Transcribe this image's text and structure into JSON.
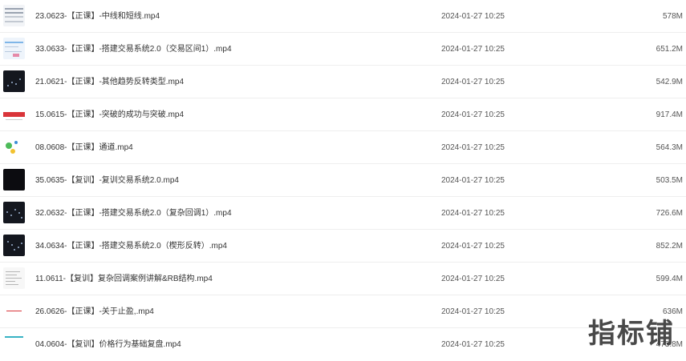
{
  "files": [
    {
      "name": "23.0623-【正课】-中线和短线.mp4",
      "date": "2024-01-27 10:25",
      "size": "578M",
      "thumb_icon": "video-thumbnail-slides"
    },
    {
      "name": "33.0633-【正课】-搭建交易系统2.0（交易区间1）.mp4",
      "date": "2024-01-27 10:25",
      "size": "651.2M",
      "thumb_icon": "video-thumbnail-light"
    },
    {
      "name": "21.0621-【正课】-其他趋势反转类型.mp4",
      "date": "2024-01-27 10:25",
      "size": "542.9M",
      "thumb_icon": "video-thumbnail-dark"
    },
    {
      "name": "15.0615-【正课】-突破的成功与突破.mp4",
      "date": "2024-01-27 10:25",
      "size": "917.4M",
      "thumb_icon": "video-thumbnail-red"
    },
    {
      "name": "08.0608-【正课】通道.mp4",
      "date": "2024-01-27 10:25",
      "size": "564.3M",
      "thumb_icon": "video-thumbnail-green"
    },
    {
      "name": "35.0635-【复训】-复训交易系统2.0.mp4",
      "date": "2024-01-27 10:25",
      "size": "503.5M",
      "thumb_icon": "video-thumbnail-black"
    },
    {
      "name": "32.0632-【正课】-搭建交易系统2.0（复杂回调1）.mp4",
      "date": "2024-01-27 10:25",
      "size": "726.6M",
      "thumb_icon": "video-thumbnail-dark"
    },
    {
      "name": "34.0634-【正课】-搭建交易系统2.0（楔形反转）.mp4",
      "date": "2024-01-27 10:25",
      "size": "852.2M",
      "thumb_icon": "video-thumbnail-dark"
    },
    {
      "name": "11.0611-【复训】复杂回调案例讲解&RB结构.mp4",
      "date": "2024-01-27 10:25",
      "size": "599.4M",
      "thumb_icon": "video-thumbnail-doc"
    },
    {
      "name": "26.0626-【正课】-关于止盈,.mp4",
      "date": "2024-01-27 10:25",
      "size": "636M",
      "thumb_icon": "video-thumbnail-redline"
    },
    {
      "name": "04.0604-【复训】价格行为基础复盘.mp4",
      "date": "2024-01-27 10:25",
      "size": "473.8M",
      "thumb_icon": "video-thumbnail-cyan"
    }
  ],
  "watermark": "指标铺"
}
